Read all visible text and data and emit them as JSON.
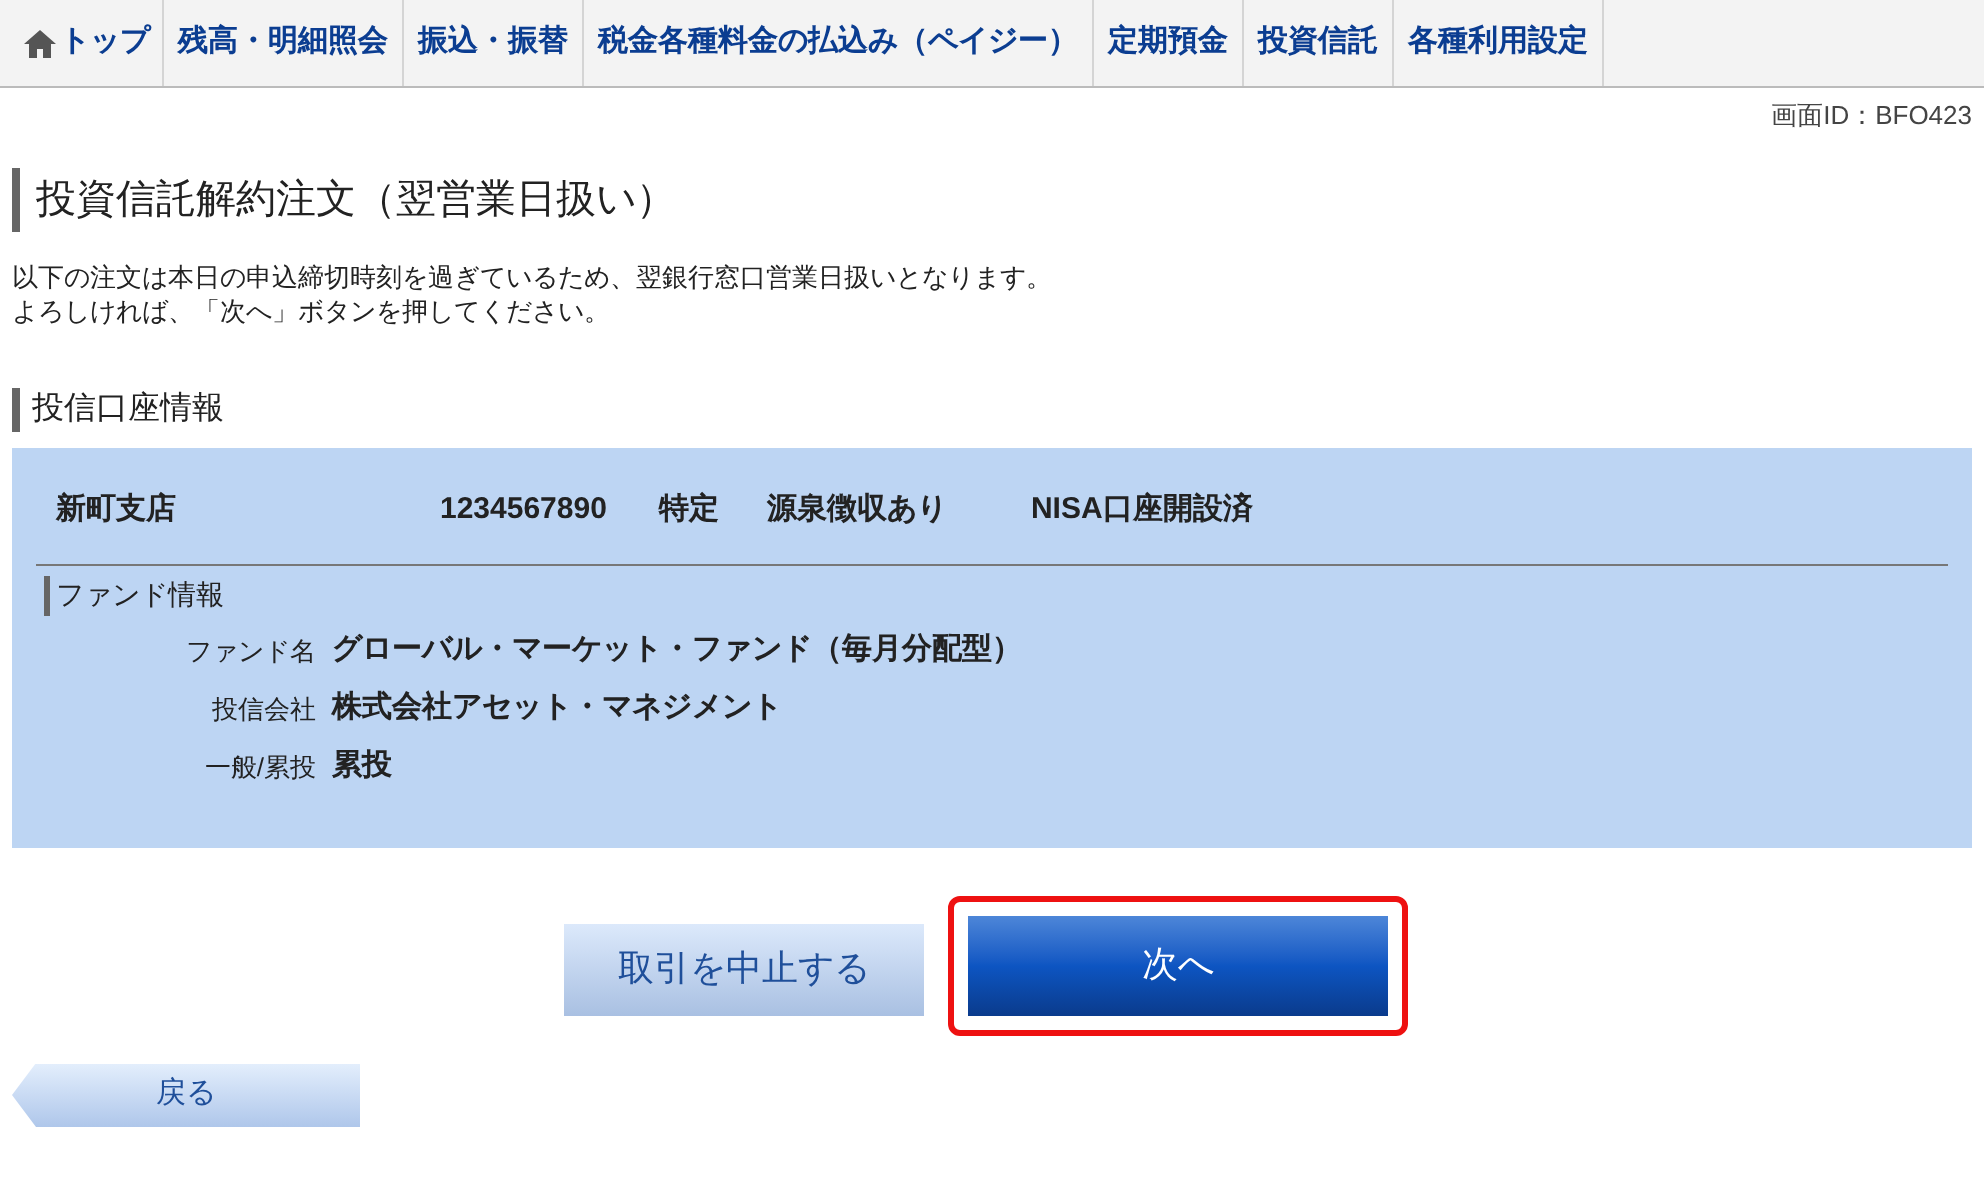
{
  "nav": [
    {
      "kind": "home",
      "label": "トップ"
    },
    {
      "kind": "text",
      "label": "残高・明細照会"
    },
    {
      "kind": "text",
      "label": "振込・振替"
    },
    {
      "kind": "text",
      "label": "税金各種料金の払込み（ペイジー）"
    },
    {
      "kind": "text",
      "label": "定期預金"
    },
    {
      "kind": "text",
      "label": "投資信託"
    },
    {
      "kind": "text",
      "label": "各種利用設定"
    }
  ],
  "screen_id": "画面ID：BFO423",
  "title": "投資信託解約注文（翌営業日扱い）",
  "notice": [
    "以下の注文は本日の申込締切時刻を過ぎているため、翌銀行窓口営業日扱いとなります。",
    "よろしければ、「次へ」ボタンを押してください。"
  ],
  "section_title": "投信口座情報",
  "account": {
    "branch": "新町支店",
    "number": "1234567890",
    "type": "特定",
    "withholding": "源泉徴収あり",
    "nisa": "NISA口座開設済"
  },
  "fund_section": "ファンド情報",
  "fund_rows": [
    {
      "label": "ファンド名",
      "value": "グローバル・マーケット・ファンド（毎月分配型）"
    },
    {
      "label": "投信会社",
      "value": "株式会社アセット・マネジメント"
    },
    {
      "label": "一般/累投",
      "value": "累投"
    }
  ],
  "cancel_button": "取引を中止する",
  "next_button": {
    "label": "次へ",
    "highlighted": true
  },
  "back_button": "戻る"
}
